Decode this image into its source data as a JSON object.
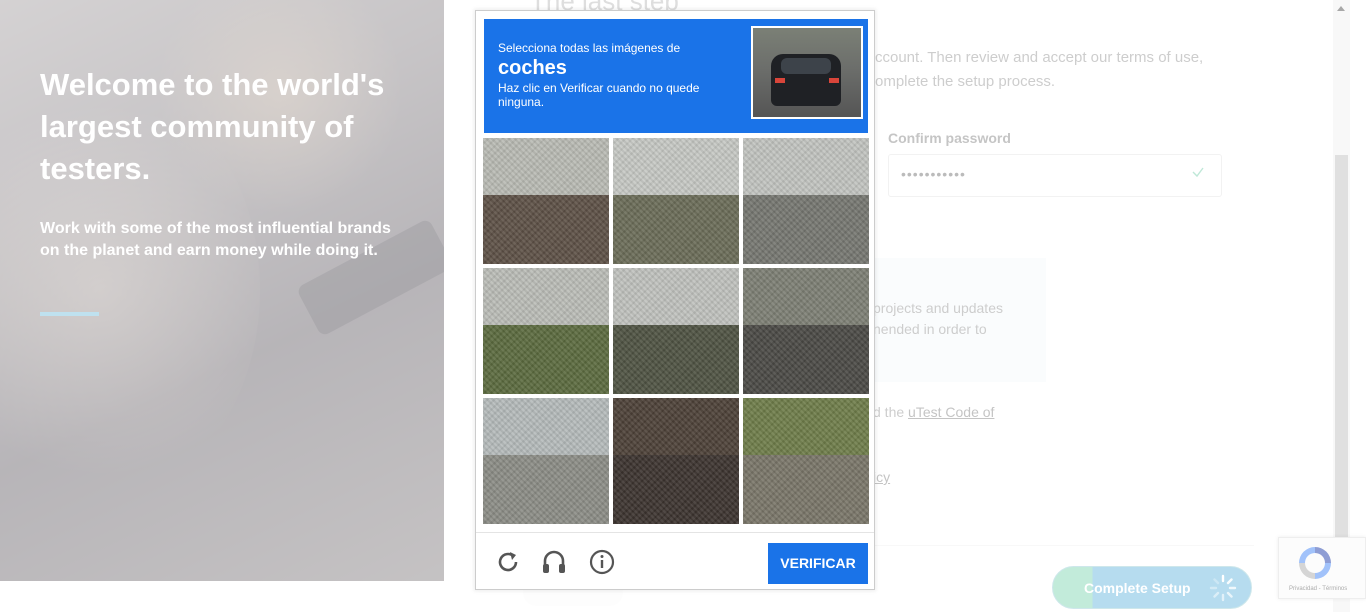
{
  "hero": {
    "title": "Welcome to the world's largest community of testers.",
    "subtitle": "Work with some of the most influential brands on the planet and earn money while doing it."
  },
  "form": {
    "step_title": "The last step",
    "description": "ccount. Then review and accept our terms of use, omplete the setup process.",
    "confirm_password_label": "Confirm password",
    "confirm_password_value": "•••••••••••",
    "notice_text": "projects and updates nended in order to",
    "code_prefix": "d the ",
    "code_link": "uTest Code of",
    "policy_fragment": "icy",
    "complete_setup_label": "Complete Setup"
  },
  "captcha": {
    "instruction_line1": "Selecciona todas las imágenes de",
    "target_word": "coches",
    "instruction_line3": "Haz clic en Verificar cuando no quede ninguna.",
    "verify_label": "VERIFICAR",
    "tiles": [
      {
        "name": "tile-1",
        "sky": "#b9bbb4",
        "ground": "#5e5147"
      },
      {
        "name": "tile-2",
        "sky": "#c6c8c4",
        "ground": "#6b6d58"
      },
      {
        "name": "tile-3",
        "sky": "#c2c4c0",
        "ground": "#767771"
      },
      {
        "name": "tile-4",
        "sky": "#bbbdb7",
        "ground": "#5c6b3f"
      },
      {
        "name": "tile-5",
        "sky": "#c0c2be",
        "ground": "#4f5343"
      },
      {
        "name": "tile-6",
        "sky": "#7d7f74",
        "ground": "#4b4a46"
      },
      {
        "name": "tile-7",
        "sky": "#b5bbbb",
        "ground": "#8c8d86"
      },
      {
        "name": "tile-8",
        "sky": "#4d4138",
        "ground": "#3c342f"
      },
      {
        "name": "tile-9",
        "sky": "#6f7d4a",
        "ground": "#7a7669"
      }
    ]
  },
  "recaptcha_badge": {
    "footer_text": "Privacidad - Términos"
  }
}
